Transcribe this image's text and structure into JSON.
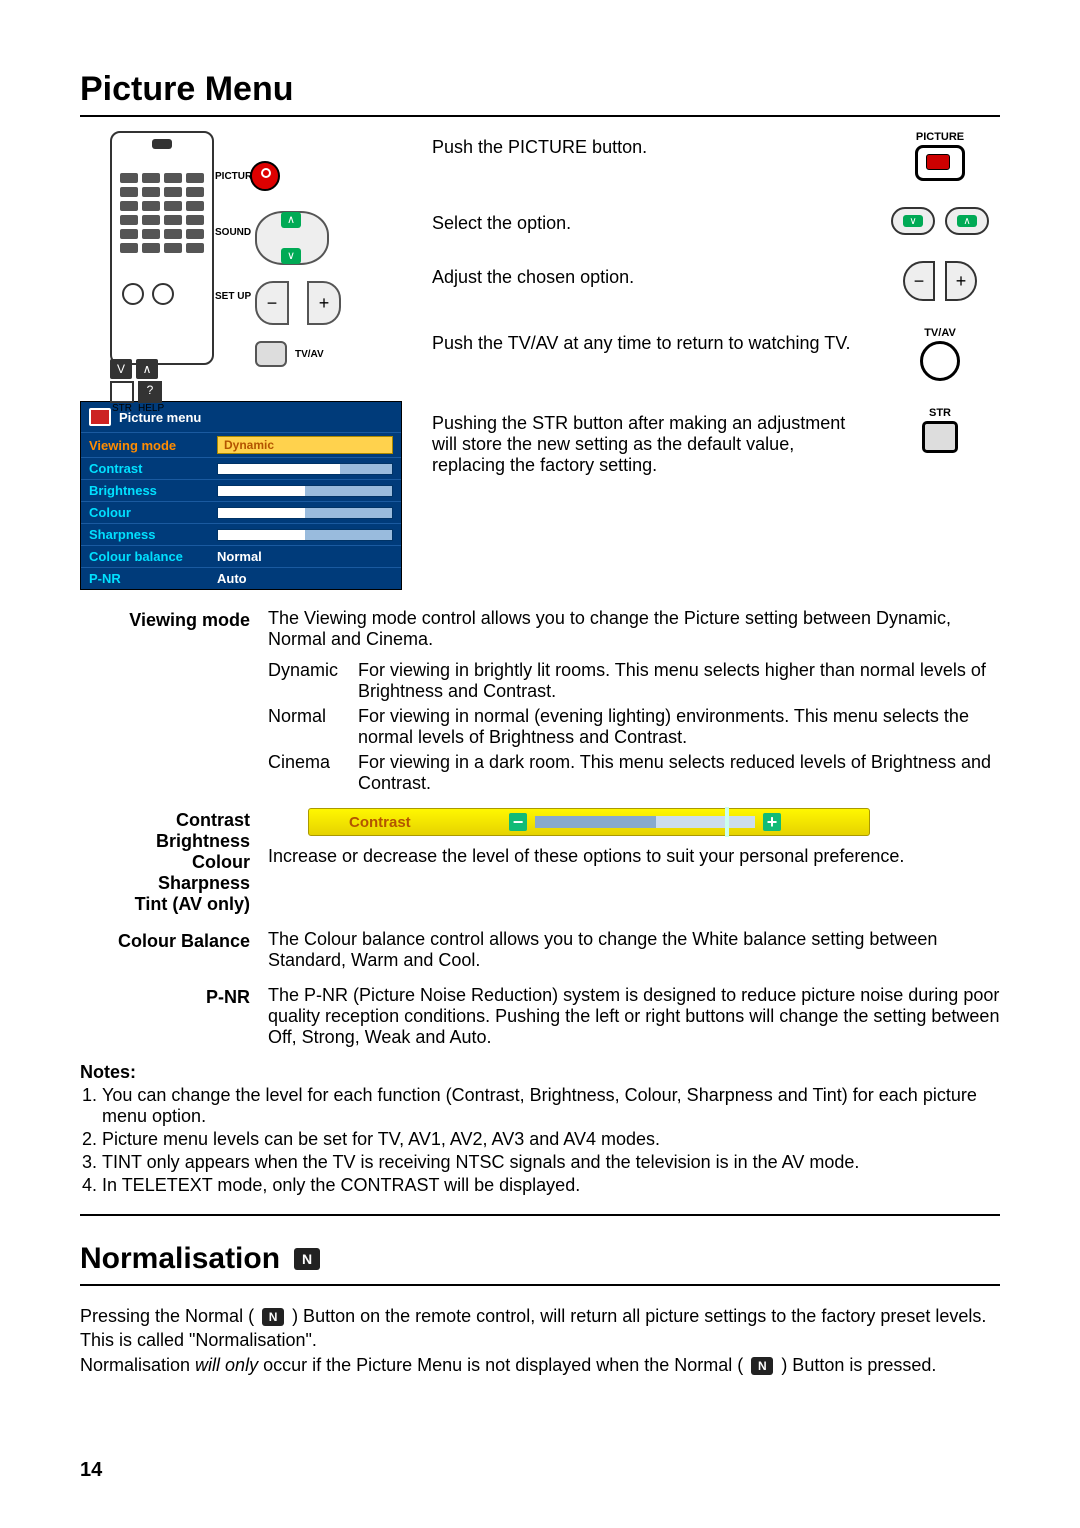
{
  "title": "Picture Menu",
  "instructions": {
    "push_picture": "Push the PICTURE button.",
    "select_option": "Select the option.",
    "adjust_option": "Adjust the chosen option.",
    "tvav": "Push the TV/AV  at any time to return to watching TV.",
    "str": "Pushing the STR button after making an adjustment will store the new setting as the default value, replacing the factory setting."
  },
  "icon_labels": {
    "picture": "PICTURE",
    "tvav": "TV/AV",
    "str": "STR"
  },
  "osd": {
    "title": "Picture  menu",
    "rows": {
      "viewing_mode": "Viewing mode",
      "viewing_mode_val": "Dynamic",
      "contrast": "Contrast",
      "brightness": "Brightness",
      "colour": "Colour",
      "sharpness": "Sharpness",
      "colour_balance": "Colour balance",
      "colour_balance_val": "Normal",
      "pnr": "P-NR",
      "pnr_val": "Auto"
    }
  },
  "defs": {
    "viewing_mode": {
      "term": "Viewing  mode",
      "desc": "The Viewing mode control allows you to change the Picture setting between Dynamic, Normal and Cinema.",
      "dynamic_l": "Dynamic",
      "dynamic": "For viewing in brightly lit rooms. This menu selects higher than normal levels of Brightness and Contrast.",
      "normal_l": "Normal",
      "normal": "For viewing in normal (evening lighting) environments. This menu selects the normal levels of Brightness and Contrast.",
      "cinema_l": "Cinema",
      "cinema": "For viewing in a dark room. This menu selects reduced levels of Brightness and Contrast."
    },
    "group": {
      "t1": "Contrast",
      "t2": "Brightness",
      "t3": "Colour",
      "t4": "Sharpness",
      "t5": "Tint (AV only)",
      "bar_label": "Contrast",
      "desc": "Increase or decrease the level of these options to suit your personal preference."
    },
    "colour_balance": {
      "term": "Colour Balance",
      "desc": "The Colour balance control allows you to change the White balance setting between Standard, Warm and Cool."
    },
    "pnr": {
      "term": "P-NR",
      "desc": "The P-NR (Picture Noise Reduction) system is designed to reduce picture noise during poor quality reception conditions. Pushing the left or right buttons will change the setting between Off, Strong, Weak and Auto."
    }
  },
  "notes": {
    "heading": "Notes:",
    "n1": "You can change the level for each function (Contrast, Brightness, Colour, Sharpness and Tint) for each picture menu option.",
    "n2": "Picture menu levels can be set for TV, AV1, AV2, AV3 and AV4 modes.",
    "n3": "TINT only appears when the TV is receiving NTSC signals and the television is in the AV mode.",
    "n4": "In TELETEXT mode, only the CONTRAST will be displayed."
  },
  "normalisation": {
    "title": "Normalisation",
    "badge": "N",
    "p1a": "Pressing the Normal ( ",
    "p1b": " ) Button on the remote control, will return all picture settings to the factory preset levels. This is called \"Normalisation\".",
    "p2a": "Normalisation ",
    "p2_em": "will only",
    "p2b": " occur if the Picture Menu is not displayed when the Normal ( ",
    "p2c": " ) Button is pressed."
  },
  "page_number": "14"
}
